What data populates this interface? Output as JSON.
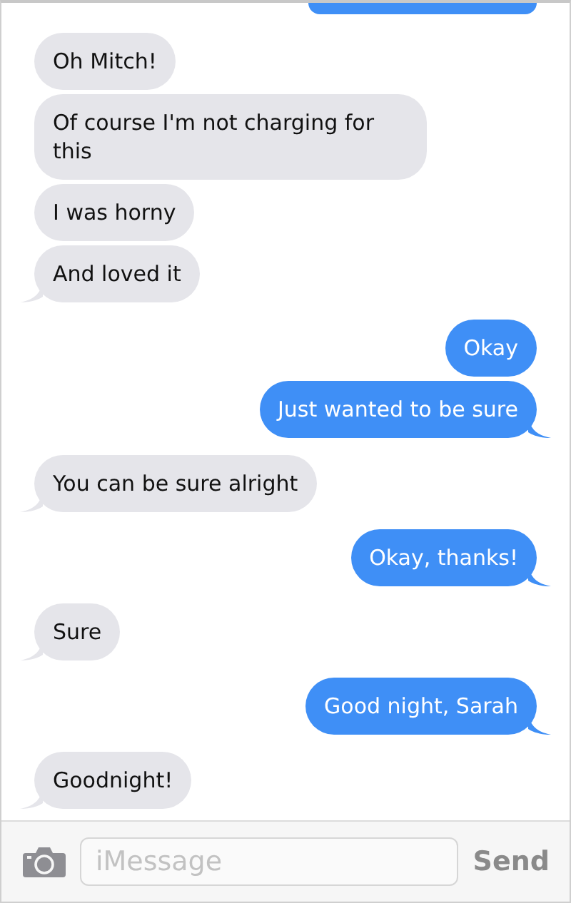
{
  "messages": [
    {
      "kind": "cutoff"
    },
    {
      "kind": "received",
      "text": "Oh Mitch!",
      "tail": false
    },
    {
      "kind": "received",
      "text": "Of course I'm not charging for this",
      "tail": false
    },
    {
      "kind": "received",
      "text": "I was horny",
      "tail": false
    },
    {
      "kind": "received",
      "text": "And loved it",
      "tail": true
    },
    {
      "kind": "sent",
      "text": "Okay",
      "tail": false
    },
    {
      "kind": "sent",
      "text": "Just wanted to be sure",
      "tail": true
    },
    {
      "kind": "received",
      "text": "You can be sure alright",
      "tail": true
    },
    {
      "kind": "sent",
      "text": "Okay, thanks!",
      "tail": true
    },
    {
      "kind": "received",
      "text": "Sure",
      "tail": true
    },
    {
      "kind": "sent",
      "text": "Good night, Sarah",
      "tail": true
    },
    {
      "kind": "received",
      "text": "Goodnight!",
      "tail": true
    }
  ],
  "composer": {
    "placeholder": "iMessage",
    "send_label": "Send"
  }
}
